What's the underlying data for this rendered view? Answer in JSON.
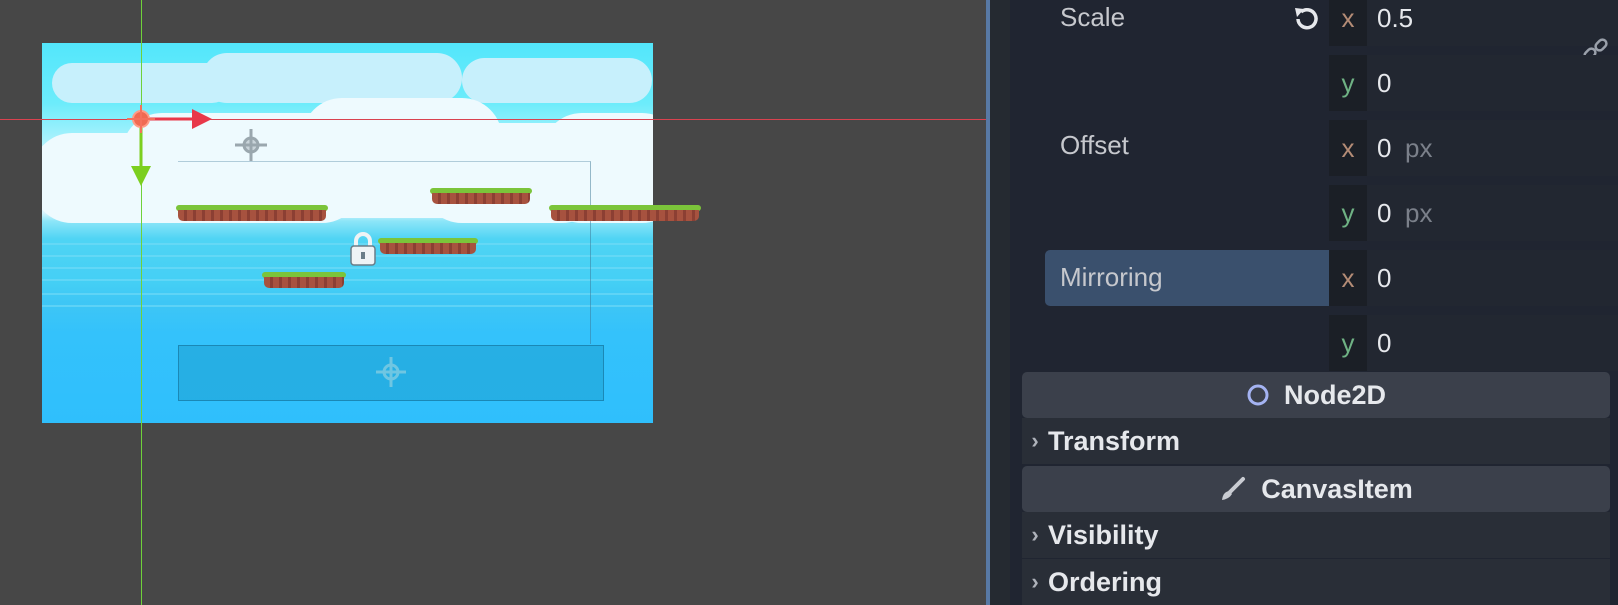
{
  "inspector": {
    "scale": {
      "label": "Scale",
      "x_axis": "x",
      "x_value": "0.5",
      "y_axis": "y",
      "y_value": "0",
      "reset_icon": "revert-icon",
      "link_icon": "unlink-icon"
    },
    "offset": {
      "label": "Offset",
      "x_axis": "x",
      "x_value": "0",
      "x_unit": "px",
      "y_axis": "y",
      "y_value": "0",
      "y_unit": "px"
    },
    "mirroring": {
      "label": "Mirroring",
      "x_axis": "x",
      "x_value": "0",
      "y_axis": "y",
      "y_value": "0"
    },
    "sections": [
      {
        "title": "Node2D",
        "icon": "node2d-circle-icon"
      },
      {
        "title": "CanvasItem",
        "icon": "brush-icon"
      }
    ],
    "categories": [
      {
        "title": "Transform"
      },
      {
        "title": "Visibility"
      },
      {
        "title": "Ordering"
      }
    ]
  },
  "viewport": {
    "gizmos": [
      "move-gizmo-icon",
      "pivot-icon",
      "lock-icon"
    ],
    "colors": {
      "x_guide": "#d9424f",
      "y_guide": "#6fd13a",
      "x_arrow": "#e8384a",
      "y_arrow": "#7ccf1f"
    }
  }
}
